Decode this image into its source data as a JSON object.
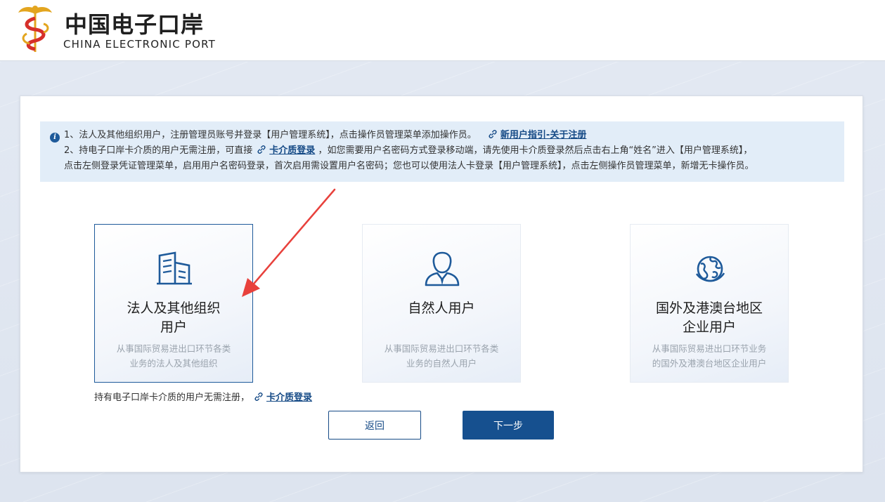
{
  "header": {
    "logo_title": "中国电子口岸",
    "logo_subtitle": "CHINA ELECTRONIC PORT"
  },
  "notice": {
    "line1_text": "1、法人及其他组织用户，注册管理员账号并登录【用户管理系统】，点击操作员管理菜单添加操作员。",
    "line1_link": "新用户指引-关于注册",
    "line2_prefix": "2、持电子口岸卡介质的用户无需注册，可直接",
    "line2_link": "卡介质登录",
    "line2_suffix": "，如您需要用户名密码方式登录移动端，请先使用卡介质登录然后点击右上角“姓名”进入【用户管理系统】，",
    "line3_text": "点击左侧登录凭证管理菜单，启用用户名密码登录，首次启用需设置用户名密码；您也可以使用法人卡登录【用户管理系统】，点击左侧操作员管理菜单，新增无卡操作员。"
  },
  "cards": [
    {
      "title_line1": "法人及其他组织",
      "title_line2": "用户",
      "desc_line1": "从事国际贸易进出口环节各类",
      "desc_line2": "业务的法人及其他组织",
      "icon": "building-icon",
      "selected": true
    },
    {
      "title_line1": "自然人用户",
      "title_line2": "",
      "desc_line1": "从事国际贸易进出口环节各类",
      "desc_line2": "业务的自然人用户",
      "icon": "person-icon",
      "selected": false
    },
    {
      "title_line1": "国外及港澳台地区",
      "title_line2": "企业用户",
      "desc_line1": "从事国际贸易进出口环节业务",
      "desc_line2": "的国外及港澳台地区企业用户",
      "icon": "globe-icon",
      "selected": false
    }
  ],
  "holder_note": {
    "text": "持有电子口岸卡介质的用户无需注册，",
    "link": "卡介质登录"
  },
  "buttons": {
    "back": "返回",
    "next": "下一步"
  },
  "colors": {
    "primary": "#16508f",
    "annotation_arrow": "#e8413c",
    "notice_bg": "#e2edf8"
  }
}
